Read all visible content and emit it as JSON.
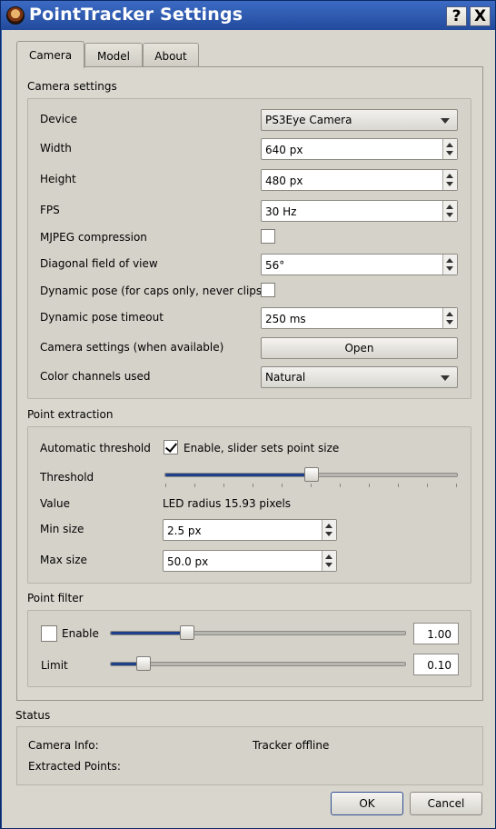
{
  "window": {
    "title": "PointTracker Settings",
    "help_label": "?",
    "close_label": "X"
  },
  "tabs": [
    "Camera",
    "Model",
    "About"
  ],
  "camera_settings": {
    "title": "Camera settings",
    "device_label": "Device",
    "device_value": "PS3Eye Camera",
    "width_label": "Width",
    "width_value": "640 px",
    "height_label": "Height",
    "height_value": "480 px",
    "fps_label": "FPS",
    "fps_value": "30 Hz",
    "mjpeg_label": "MJPEG compression",
    "mjpeg_checked": false,
    "fov_label": "Diagonal field of view",
    "fov_value": "56°",
    "dynamic_pose_label": "Dynamic pose (for caps only, never clips)",
    "dynamic_pose_checked": false,
    "dynamic_timeout_label": "Dynamic pose timeout",
    "dynamic_timeout_value": "250 ms",
    "cam_settings_label": "Camera settings (when available)",
    "open_button": "Open",
    "color_label": "Color channels used",
    "color_value": "Natural"
  },
  "point_extraction": {
    "title": "Point extraction",
    "auto_threshold_label": "Automatic threshold",
    "auto_threshold_checkbox_label": "Enable, slider sets point size",
    "auto_threshold_checked": true,
    "threshold_label": "Threshold",
    "threshold_fraction": 0.5,
    "value_label": "Value",
    "value_text": "LED radius 15.93 pixels",
    "min_size_label": "Min size",
    "min_size_value": "2.5 px",
    "max_size_label": "Max size",
    "max_size_value": "50.0 px"
  },
  "point_filter": {
    "title": "Point filter",
    "enable_label": "Enable",
    "enable_checked": false,
    "enable_slider_fraction": 0.26,
    "enable_value": "1.00",
    "limit_label": "Limit",
    "limit_slider_fraction": 0.11,
    "limit_value": "0.10"
  },
  "status": {
    "title": "Status",
    "camera_info_label": "Camera Info:",
    "camera_info_value": "Tracker offline",
    "extracted_points_label": "Extracted Points:",
    "extracted_points_value": ""
  },
  "buttons": {
    "ok": "OK",
    "cancel": "Cancel"
  },
  "colors": {
    "title_bar": "#224a9c",
    "slider_fill": "#1e3f8a",
    "dialog_bg": "#d9d6ce"
  }
}
